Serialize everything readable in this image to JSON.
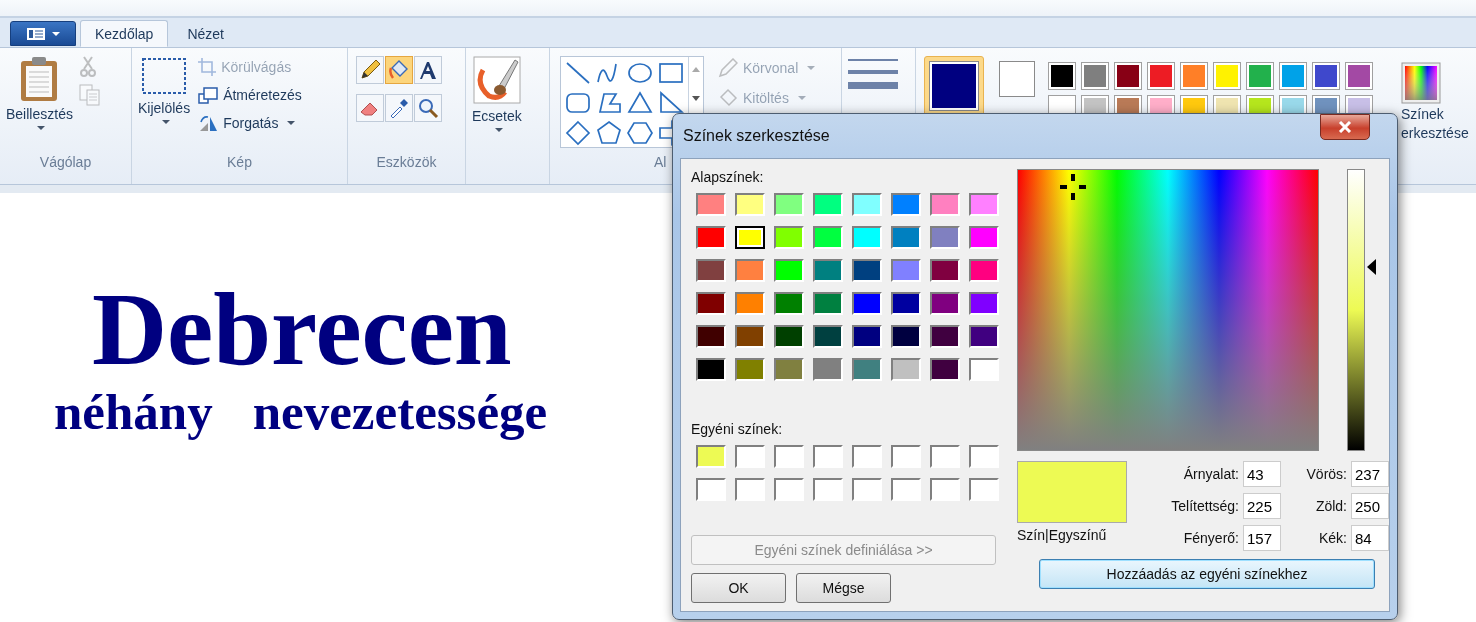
{
  "tabs": [
    {
      "label": "Kezdőlap",
      "selected": true
    },
    {
      "label": "Nézet",
      "selected": false
    }
  ],
  "clipboard": {
    "paste": "Beillesztés",
    "cut_disabled": true,
    "copy_disabled": true,
    "group": "Vágólap"
  },
  "image": {
    "select": "Kijelölés",
    "crop": {
      "label": "Körülvágás",
      "disabled": true
    },
    "resize": {
      "label": "Átméretezés",
      "disabled": false
    },
    "rotate": {
      "label": "Forgatás",
      "disabled": false
    },
    "group": "Kép"
  },
  "tools": {
    "group": "Eszközök",
    "items": [
      {
        "kind": "pencil",
        "selected": false
      },
      {
        "kind": "fill",
        "selected": true
      },
      {
        "kind": "text",
        "selected": false
      },
      {
        "kind": "eraser",
        "selected": false
      },
      {
        "kind": "picker",
        "selected": false
      },
      {
        "kind": "magnifier",
        "selected": false
      }
    ]
  },
  "brushes": {
    "label": "Ecsetek"
  },
  "shapes": {
    "group": "Al",
    "items": [
      {
        "kind": "line"
      },
      {
        "kind": "curve"
      },
      {
        "kind": "oval"
      },
      {
        "kind": "rect"
      },
      {
        "kind": "roundrect"
      },
      {
        "kind": "polygon"
      },
      {
        "kind": "triangle"
      },
      {
        "kind": "righttriangle"
      },
      {
        "kind": "diamond"
      },
      {
        "kind": "pentagon"
      },
      {
        "kind": "hexagon"
      },
      {
        "kind": "arrow"
      }
    ],
    "outline": {
      "label": "Körvonal",
      "disabled": true
    },
    "fill": {
      "label": "Kitöltés",
      "disabled": true
    }
  },
  "colors": {
    "color1": {
      "color": "#000080",
      "selected": true
    },
    "color2": {
      "color": "#ffffff",
      "selected": false
    },
    "palette": [
      {
        "color": "#000000"
      },
      {
        "color": "#7f7f7f"
      },
      {
        "color": "#880015"
      },
      {
        "color": "#ed1c24"
      },
      {
        "color": "#ff7f27"
      },
      {
        "color": "#fff200"
      },
      {
        "color": "#22b14c"
      },
      {
        "color": "#00a2e8"
      },
      {
        "color": "#3f48cc"
      },
      {
        "color": "#a349a4"
      },
      {
        "color": "#ffffff"
      },
      {
        "color": "#c3c3c3"
      },
      {
        "color": "#b97a57"
      },
      {
        "color": "#ffaec9"
      },
      {
        "color": "#ffc90e"
      },
      {
        "color": "#efe4b0"
      },
      {
        "color": "#b5e61d"
      },
      {
        "color": "#99d9ea"
      },
      {
        "color": "#7092be"
      },
      {
        "color": "#c8bfe7"
      }
    ],
    "edit_label": [
      "Színek",
      "erkesztése"
    ]
  },
  "canvas": {
    "title": "Debrecen",
    "subtitle": [
      "néhány",
      "nevezetessége"
    ]
  },
  "dialog": {
    "title": "Színek szerkesztése",
    "basic_label": "Alapszínek:",
    "basic_colors": [
      {
        "color": "#ff8080",
        "selected": false
      },
      {
        "color": "#ffff80",
        "selected": false
      },
      {
        "color": "#80ff80",
        "selected": false
      },
      {
        "color": "#00ff80",
        "selected": false
      },
      {
        "color": "#80ffff",
        "selected": false
      },
      {
        "color": "#0080ff",
        "selected": false
      },
      {
        "color": "#ff80c0",
        "selected": false
      },
      {
        "color": "#ff80ff",
        "selected": false
      },
      {
        "color": "#ff0000",
        "selected": false
      },
      {
        "color": "#ffff00",
        "selected": true
      },
      {
        "color": "#80ff00",
        "selected": false
      },
      {
        "color": "#00ff40",
        "selected": false
      },
      {
        "color": "#00ffff",
        "selected": false
      },
      {
        "color": "#0080c0",
        "selected": false
      },
      {
        "color": "#8080c0",
        "selected": false
      },
      {
        "color": "#ff00ff",
        "selected": false
      },
      {
        "color": "#804040",
        "selected": false
      },
      {
        "color": "#ff8040",
        "selected": false
      },
      {
        "color": "#00ff00",
        "selected": false
      },
      {
        "color": "#008080",
        "selected": false
      },
      {
        "color": "#004080",
        "selected": false
      },
      {
        "color": "#8080ff",
        "selected": false
      },
      {
        "color": "#800040",
        "selected": false
      },
      {
        "color": "#ff0080",
        "selected": false
      },
      {
        "color": "#800000",
        "selected": false
      },
      {
        "color": "#ff8000",
        "selected": false
      },
      {
        "color": "#008000",
        "selected": false
      },
      {
        "color": "#008040",
        "selected": false
      },
      {
        "color": "#0000ff",
        "selected": false
      },
      {
        "color": "#0000a0",
        "selected": false
      },
      {
        "color": "#800080",
        "selected": false
      },
      {
        "color": "#8000ff",
        "selected": false
      },
      {
        "color": "#400000",
        "selected": false
      },
      {
        "color": "#804000",
        "selected": false
      },
      {
        "color": "#004000",
        "selected": false
      },
      {
        "color": "#004040",
        "selected": false
      },
      {
        "color": "#000080",
        "selected": false
      },
      {
        "color": "#000040",
        "selected": false
      },
      {
        "color": "#400040",
        "selected": false
      },
      {
        "color": "#400080",
        "selected": false
      },
      {
        "color": "#000000",
        "selected": false
      },
      {
        "color": "#808000",
        "selected": false
      },
      {
        "color": "#808040",
        "selected": false
      },
      {
        "color": "#808080",
        "selected": false
      },
      {
        "color": "#408080",
        "selected": false
      },
      {
        "color": "#c0c0c0",
        "selected": false
      },
      {
        "color": "#400040",
        "selected": false
      },
      {
        "color": "#ffffff",
        "selected": false
      }
    ],
    "custom_label": "Egyéni színek:",
    "custom_colors": [
      {
        "color": "#edfa54"
      },
      {
        "color": "#ffffff"
      },
      {
        "color": "#ffffff"
      },
      {
        "color": "#ffffff"
      },
      {
        "color": "#ffffff"
      },
      {
        "color": "#ffffff"
      },
      {
        "color": "#ffffff"
      },
      {
        "color": "#ffffff"
      },
      {
        "color": "#ffffff"
      },
      {
        "color": "#ffffff"
      },
      {
        "color": "#ffffff"
      },
      {
        "color": "#ffffff"
      },
      {
        "color": "#ffffff"
      },
      {
        "color": "#ffffff"
      },
      {
        "color": "#ffffff"
      },
      {
        "color": "#ffffff"
      }
    ],
    "define_button": {
      "label": "Egyéni színek definiálása >>",
      "disabled": true
    },
    "ok": "OK",
    "cancel": "Mégse",
    "preview": {
      "color": "#edfa54",
      "label": "Szín|Egyszínű"
    },
    "fields": [
      {
        "label": "Árnyalat:",
        "value": "43"
      },
      {
        "label": "Vörös:",
        "value": "237"
      },
      {
        "label": "Telítettség:",
        "value": "225"
      },
      {
        "label": "Zöld:",
        "value": "250"
      },
      {
        "label": "Fényerő:",
        "value": "157"
      },
      {
        "label": "Kék:",
        "value": "84"
      }
    ],
    "add_button": "Hozzáadás az egyéni színekhez"
  }
}
